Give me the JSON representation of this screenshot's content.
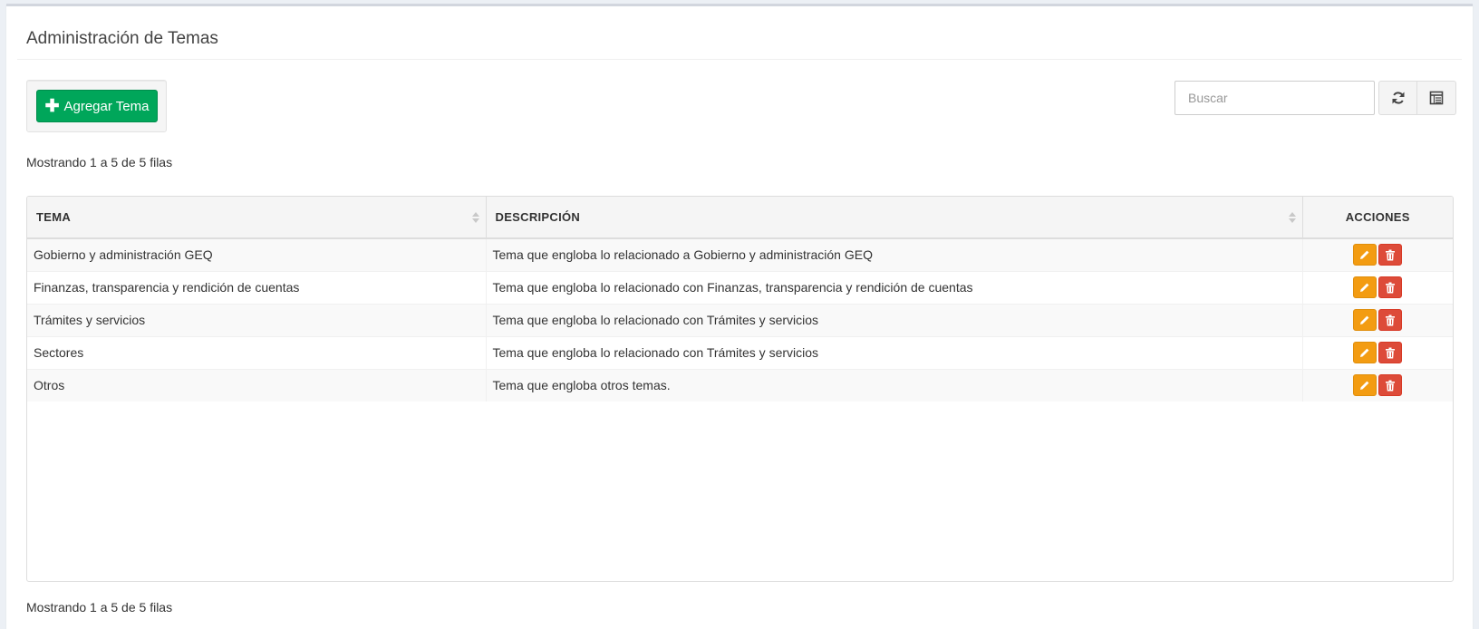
{
  "page": {
    "title": "Administración de Temas"
  },
  "toolbar": {
    "add_label": "Agregar Tema",
    "search_placeholder": "Buscar",
    "refresh_icon": "refresh-icon",
    "columns_icon": "columns-list-icon"
  },
  "pagination": {
    "top_info": "Mostrando 1 a 5 de 5 filas",
    "bottom_info": "Mostrando 1 a 5 de 5 filas"
  },
  "table": {
    "columns": [
      "TEMA",
      "DESCRIPCIÓN",
      "ACCIONES"
    ],
    "rows": [
      {
        "tema": "Gobierno y administración GEQ",
        "descripcion": "Tema que engloba lo relacionado a Gobierno y administración GEQ"
      },
      {
        "tema": "Finanzas, transparencia y rendición de cuentas",
        "descripcion": "Tema que engloba lo relacionado con Finanzas, transparencia y rendición de cuentas"
      },
      {
        "tema": "Trámites y servicios",
        "descripcion": "Tema que engloba lo relacionado con Trámites y servicios"
      },
      {
        "tema": "Sectores",
        "descripcion": "Tema que engloba lo relacionado con Trámites y servicios"
      },
      {
        "tema": "Otros",
        "descripcion": "Tema que engloba otros temas."
      }
    ],
    "row_actions": [
      "pencil-icon",
      "trash-icon"
    ]
  },
  "colors": {
    "add_button": "#00a65a",
    "edit_button": "#f39c12",
    "delete_button": "#dd4b39",
    "background": "#ecf0f5"
  }
}
